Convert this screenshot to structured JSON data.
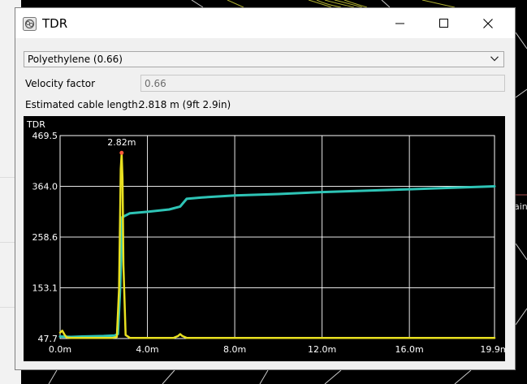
{
  "window": {
    "title": "TDR"
  },
  "material": {
    "selected": "Polyethylene (0.66)"
  },
  "velocity_factor": {
    "label": "Velocity factor",
    "value": "0.66"
  },
  "cable_length": {
    "label": "Estimated cable length:",
    "value": "2.818 m (9ft 2.9in)"
  },
  "background": {
    "partial_label": "ain"
  },
  "icons": {
    "app": "tdr-app-icon",
    "minimize": "minimize-icon",
    "maximize": "maximize-icon",
    "close": "close-icon",
    "dropdown": "chevron-down-icon"
  },
  "colors": {
    "impedance_trace": "#2ec4b6",
    "reflection_trace": "#e8e020",
    "peak_marker": "#ff5a3c",
    "grid": "#ffffff",
    "chart_bg": "#000000"
  },
  "chart_data": {
    "type": "line",
    "title": "TDR",
    "xlabel": "",
    "ylabel": "",
    "xlim": [
      0.0,
      19.9
    ],
    "ylim": [
      47.7,
      469.5
    ],
    "x_tick_labels": [
      "0.0m",
      "4.0m",
      "8.0m",
      "12.0m",
      "16.0m",
      "19.9m"
    ],
    "x_ticks": [
      0.0,
      4.0,
      8.0,
      12.0,
      16.0,
      19.9
    ],
    "y_tick_labels": [
      "469.5",
      "364.0",
      "258.6",
      "153.1",
      "47.7"
    ],
    "y_ticks": [
      469.5,
      364.0,
      258.6,
      153.1,
      47.7
    ],
    "grid": true,
    "annotations": [
      {
        "label": "2.82m",
        "x": 2.82,
        "y": 432
      }
    ],
    "series": [
      {
        "color": "#2ec4b6",
        "x": [
          0.0,
          0.5,
          1.0,
          2.0,
          2.5,
          2.65,
          2.75,
          2.85,
          3.2,
          4.0,
          5.0,
          5.5,
          5.8,
          6.5,
          8.0,
          10.0,
          12.0,
          14.0,
          16.0,
          18.0,
          19.9
        ],
        "y": [
          52,
          51,
          52,
          53,
          54,
          57,
          150,
          300,
          308,
          311,
          316,
          322,
          338,
          341,
          345,
          348,
          352,
          355,
          358,
          361,
          364
        ]
      },
      {
        "color": "#e8e020",
        "x": [
          0.0,
          0.1,
          0.2,
          0.3,
          0.5,
          2.4,
          2.6,
          2.7,
          2.75,
          2.78,
          2.82,
          2.86,
          2.9,
          3.0,
          3.2,
          5.2,
          5.4,
          5.5,
          5.6,
          5.8,
          19.9
        ],
        "y": [
          60,
          64,
          56,
          50,
          49,
          49,
          51,
          150,
          300,
          400,
          432,
          380,
          200,
          55,
          49,
          49,
          53,
          57,
          53,
          49,
          49
        ]
      }
    ]
  }
}
